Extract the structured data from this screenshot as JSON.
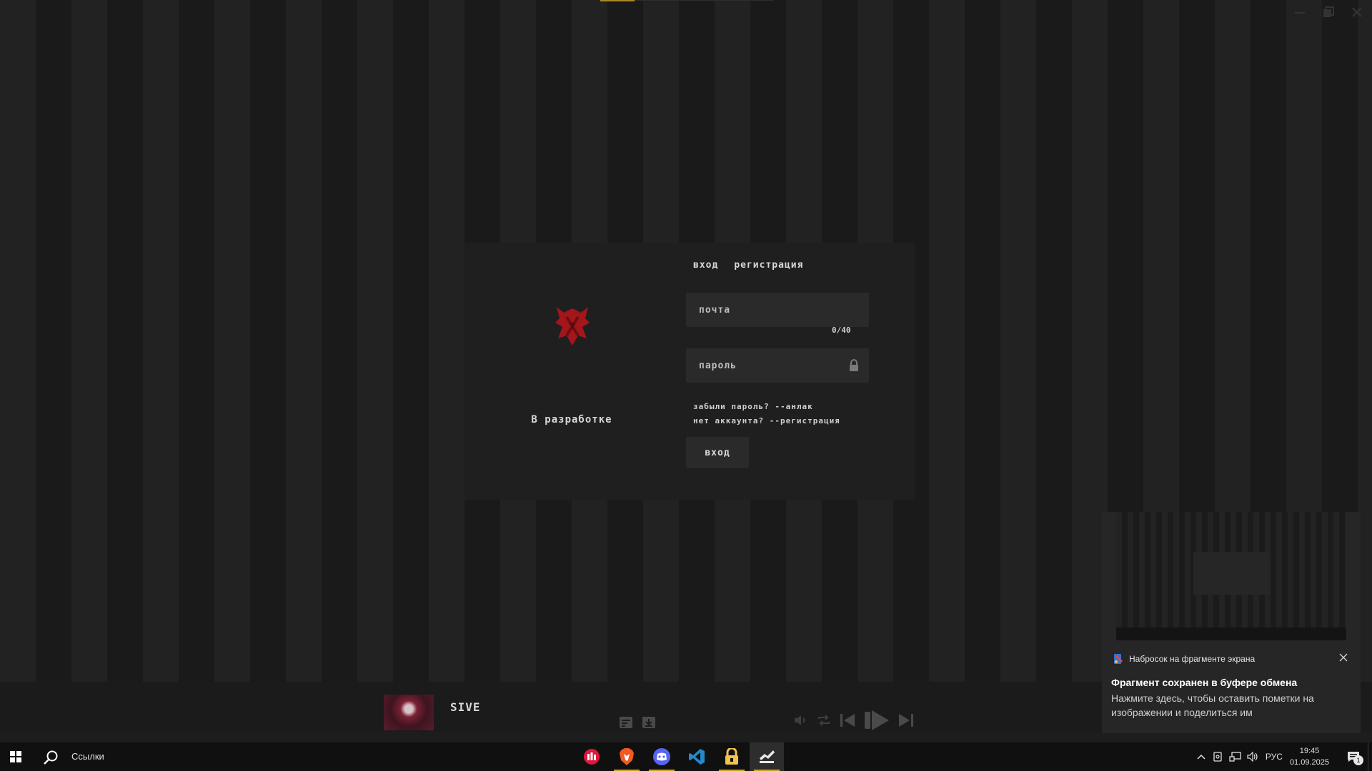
{
  "window": {
    "controls": [
      "minimize",
      "restore",
      "close"
    ]
  },
  "login": {
    "tabs": {
      "login": "вход",
      "register": "регистрация"
    },
    "email_placeholder": "почта",
    "email_counter": "0/40",
    "password_placeholder": "пароль",
    "forgot": "забыли пароль? --анлак",
    "no_account": "нет аккаунта? --регистрация",
    "submit": "вход",
    "side_label": "В разработке"
  },
  "player": {
    "track_title": "SIVE"
  },
  "notification": {
    "app_name": "Набросок на фрагменте экрана",
    "title": "Фрагмент сохранен в буфере обмена",
    "body": "Нажмите здесь, чтобы оставить пометки на изображении и поделиться им"
  },
  "taskbar": {
    "search_label": "Ссылки",
    "apps": [
      "yandex-music-icon",
      "brave-icon",
      "discord-icon",
      "vscode-icon",
      "keepass-icon",
      "app-icon"
    ],
    "language": "РУС",
    "time": "19:45",
    "date": "01.09.2025",
    "notifications_count": "1"
  },
  "colors": {
    "accent": "#c9a227",
    "logo_red": "#a3161b",
    "background_dark": "#1a1a1a",
    "background_light": "#222222"
  }
}
